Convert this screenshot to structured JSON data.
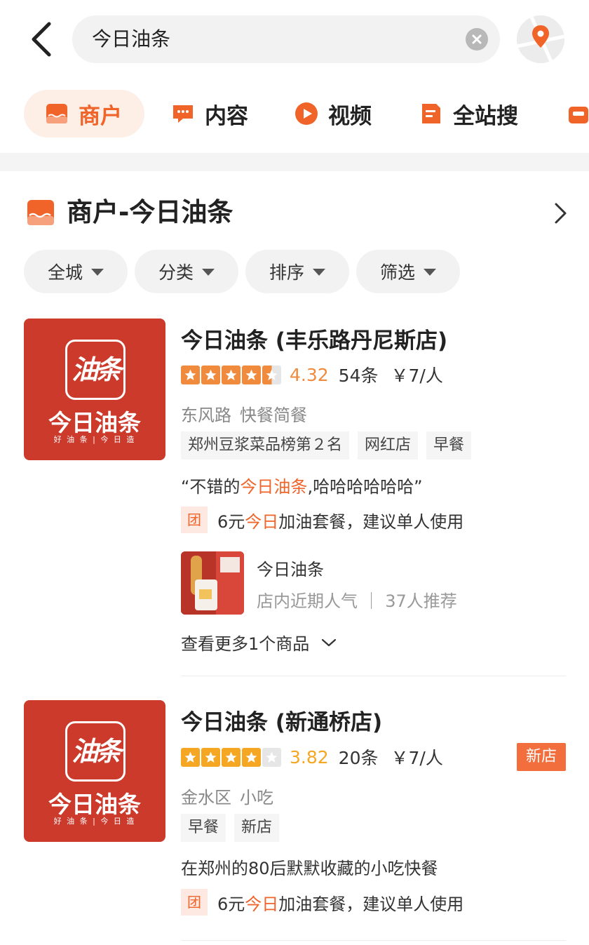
{
  "search": {
    "query": "今日油条"
  },
  "tabs": [
    {
      "label": "商户",
      "icon": "shop-icon",
      "active": true
    },
    {
      "label": "内容",
      "icon": "comment-icon",
      "active": false
    },
    {
      "label": "视频",
      "icon": "play-icon",
      "active": false
    },
    {
      "label": "全站搜",
      "icon": "document-icon",
      "active": false
    },
    {
      "label": "",
      "icon": "bag-icon",
      "active": false
    }
  ],
  "section": {
    "title": "商户-今日油条"
  },
  "filters": [
    {
      "label": "全城"
    },
    {
      "label": "分类"
    },
    {
      "label": "排序"
    },
    {
      "label": "筛选"
    }
  ],
  "shops": [
    {
      "logo": {
        "glyph": "油条",
        "brand": "今日油条",
        "slogan": "好 油 条 | 今 日 造"
      },
      "name": "今日油条 (丰乐路丹尼斯店)",
      "rating": 4.32,
      "score_text": "4.32",
      "reviews": "54条",
      "price": "￥7/人",
      "area": "东风路",
      "category": "快餐简餐",
      "tags": [
        "郑州豆浆菜品榜第２名",
        "网红店",
        "早餐"
      ],
      "quote": {
        "before": "“不错的",
        "highlight": "今日油条",
        "after": ",哈哈哈哈哈哈”"
      },
      "deal": {
        "badge": "团",
        "before": "6元 ",
        "highlight": "今日",
        "after": "加油套餐，建议单人使用"
      },
      "product": {
        "name": "今日油条",
        "sub": "店内近期人气 ｜ 37人推荐"
      },
      "more": "查看更多1个商品"
    },
    {
      "logo": {
        "glyph": "油条",
        "brand": "今日油条",
        "slogan": "好 油 条 | 今 日 造"
      },
      "name": "今日油条 (新通桥店)",
      "rating": 3.82,
      "score_text": "3.82",
      "reviews": "20条",
      "price": "￥7/人",
      "badge": "新店",
      "area": "金水区",
      "category": "小吃",
      "tags": [
        "早餐",
        "新店"
      ],
      "quote_plain": "在郑州的80后默默收藏的小吃快餐",
      "deal": {
        "badge": "团",
        "before": "6元 ",
        "highlight": "今日",
        "after": "加油套餐，建议单人使用"
      }
    }
  ],
  "colors": {
    "accent": "#f0642a",
    "star_filled_1": "#f08a3c",
    "star_filled_2": "#f5a623",
    "star_empty": "#e6e6e6",
    "logo_red": "#cc3a2c",
    "score_1": "#f08a3c",
    "score_2": "#f5a623"
  }
}
